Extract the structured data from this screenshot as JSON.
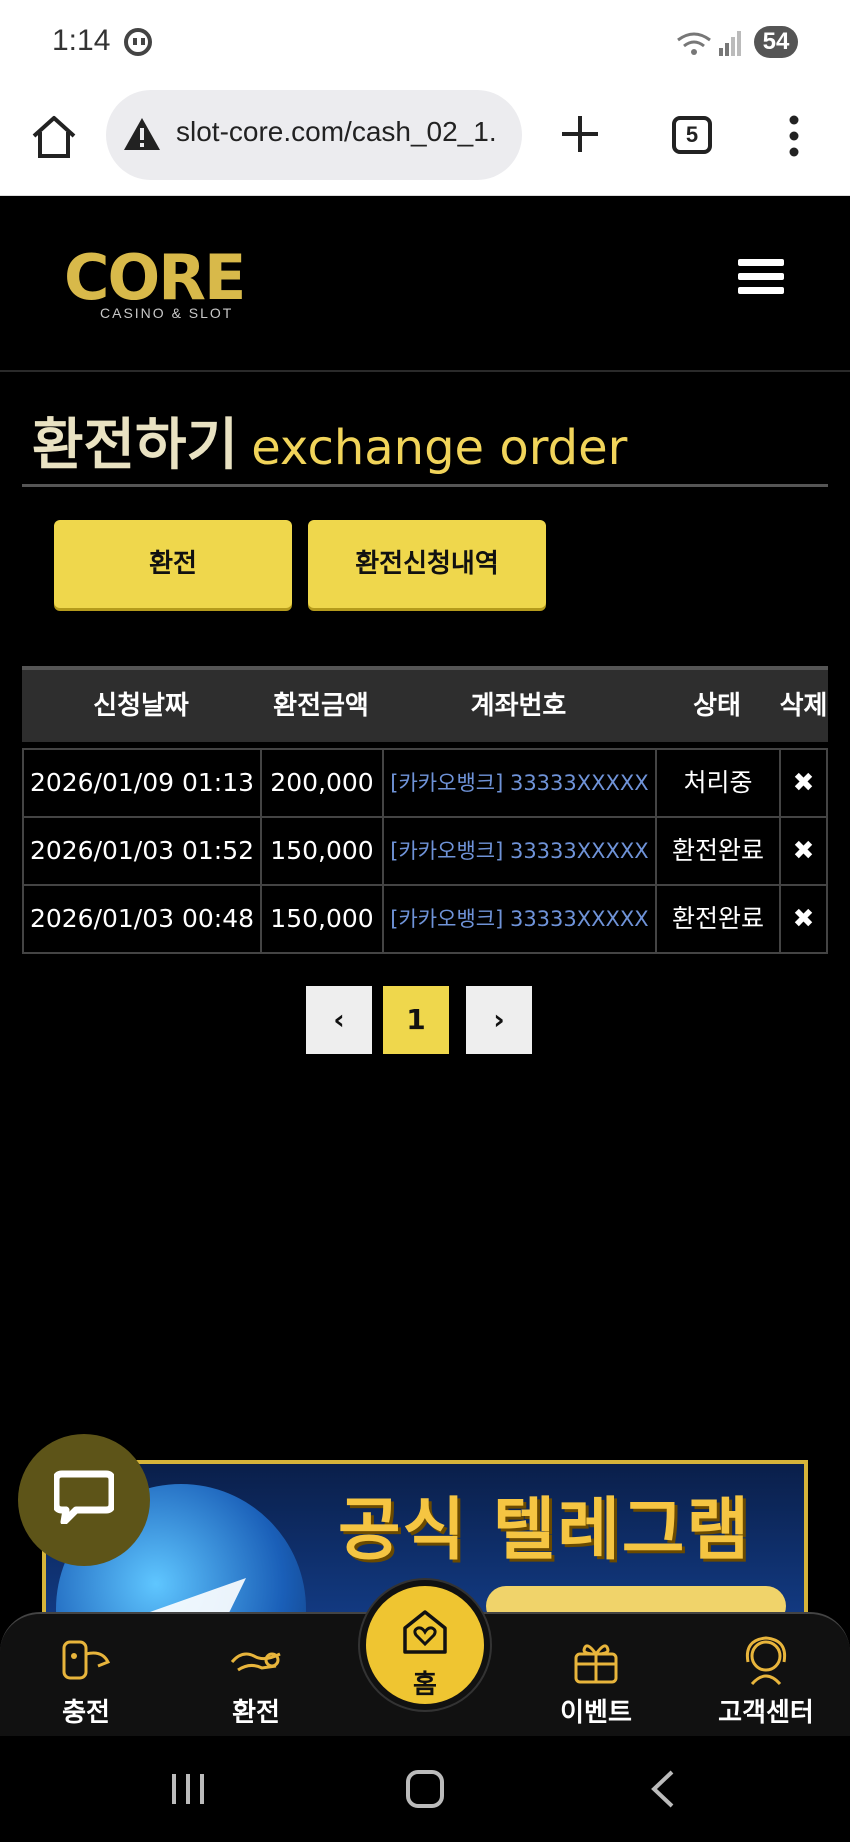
{
  "status_bar": {
    "time": "1:14",
    "battery": "54"
  },
  "browser": {
    "url": "slot-core.com/cash_02_1.",
    "tab_count": "5"
  },
  "site": {
    "logo_text": "CORE",
    "logo_sub": "CASINO & SLOT"
  },
  "page": {
    "title_ko": "환전하기",
    "title_en": "exchange order"
  },
  "buttons": {
    "exchange": "환전",
    "history": "환전신청내역"
  },
  "table": {
    "headers": [
      "신청날짜",
      "환전금액",
      "계좌번호",
      "상태",
      "삭제"
    ],
    "rows": [
      {
        "date": "2026/01/09 01:13",
        "amount": "200,000",
        "account": "[카카오뱅크] 33333XXXXX",
        "status": "처리중",
        "delete": "✖"
      },
      {
        "date": "2026/01/03 01:52",
        "amount": "150,000",
        "account": "[카카오뱅크] 33333XXXXX",
        "status": "환전완료",
        "delete": "✖"
      },
      {
        "date": "2026/01/03 00:48",
        "amount": "150,000",
        "account": "[카카오뱅크] 33333XXXXX",
        "status": "환전완료",
        "delete": "✖"
      }
    ]
  },
  "pagination": {
    "prev": "‹",
    "current": "1",
    "next": "›"
  },
  "banner": {
    "text": "공식 텔레그램"
  },
  "bottom_nav": {
    "charge": "충전",
    "exchange": "환전",
    "home": "홈",
    "event": "이벤트",
    "support": "고객센터"
  },
  "colors": {
    "accent": "#efd74c",
    "background": "#000000",
    "link": "#6f93d8"
  }
}
